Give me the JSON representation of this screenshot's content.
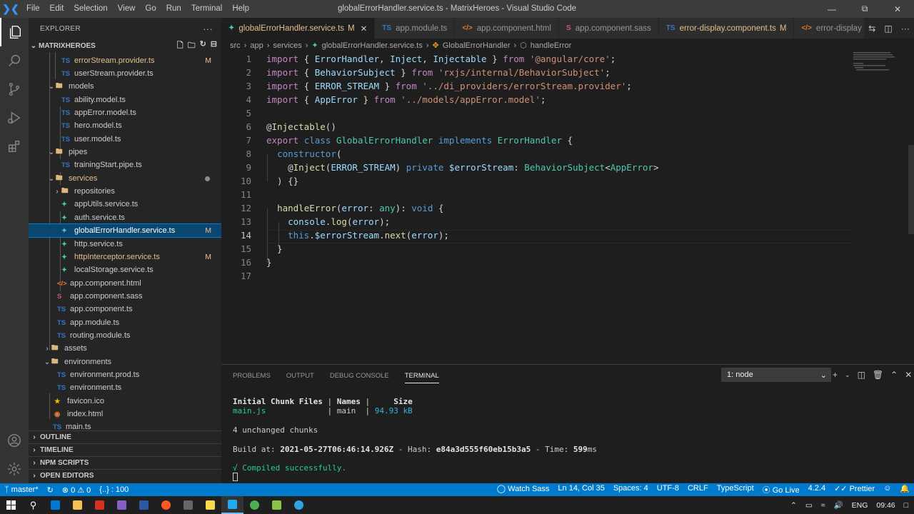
{
  "titlebar": {
    "menu": [
      "File",
      "Edit",
      "Selection",
      "View",
      "Go",
      "Run",
      "Terminal",
      "Help"
    ],
    "window_title": "globalErrorHandler.service.ts - MatrixHeroes - Visual Studio Code"
  },
  "explorer": {
    "title": "EXPLORER",
    "project": "MATRIXHEROES",
    "items": [
      {
        "label": "errorStream.provider.ts",
        "badge": "M"
      },
      {
        "label": "userStream.provider.ts"
      },
      {
        "label": "models"
      },
      {
        "label": "ability.model.ts"
      },
      {
        "label": "appError.model.ts"
      },
      {
        "label": "hero.model.ts"
      },
      {
        "label": "user.model.ts"
      },
      {
        "label": "pipes"
      },
      {
        "label": "trainingStart.pipe.ts"
      },
      {
        "label": "services"
      },
      {
        "label": "repositories"
      },
      {
        "label": "appUtils.service.ts"
      },
      {
        "label": "auth.service.ts"
      },
      {
        "label": "globalErrorHandler.service.ts",
        "badge": "M"
      },
      {
        "label": "http.service.ts"
      },
      {
        "label": "httpInterceptor.service.ts",
        "badge": "M"
      },
      {
        "label": "localStorage.service.ts"
      },
      {
        "label": "app.component.html"
      },
      {
        "label": "app.component.sass"
      },
      {
        "label": "app.component.ts"
      },
      {
        "label": "app.module.ts"
      },
      {
        "label": "routing.module.ts"
      },
      {
        "label": "assets"
      },
      {
        "label": "environments"
      },
      {
        "label": "environment.prod.ts"
      },
      {
        "label": "environment.ts"
      },
      {
        "label": "favicon.ico"
      },
      {
        "label": "index.html"
      },
      {
        "label": "main.ts"
      }
    ],
    "sections": [
      "OUTLINE",
      "TIMELINE",
      "NPM SCRIPTS",
      "OPEN EDITORS"
    ]
  },
  "tabs": [
    {
      "icon": "TS",
      "label": "globalErrorHandler.service.ts",
      "mod": "M"
    },
    {
      "icon": "TS",
      "label": "app.module.ts"
    },
    {
      "icon": "</>",
      "label": "app.component.html"
    },
    {
      "icon": "S",
      "label": "app.component.sass"
    },
    {
      "icon": "TS",
      "label": "error-display.component.ts",
      "mod": "M"
    },
    {
      "icon": "</>",
      "label": "error-display"
    }
  ],
  "breadcrumb": [
    "src",
    "app",
    "services",
    "globalErrorHandler.service.ts",
    "GlobalErrorHandler",
    "handleError"
  ],
  "code": {
    "line_numbers": [
      "1",
      "2",
      "3",
      "4",
      "5",
      "6",
      "7",
      "8",
      "9",
      "10",
      "11",
      "12",
      "13",
      "14",
      "15",
      "16",
      "17"
    ],
    "current_line": "14",
    "l1": {
      "a": "import",
      "b": " { ",
      "c": "ErrorHandler",
      "d": ", ",
      "e": "Inject",
      "f": ", ",
      "g": "Injectable",
      "h": " } ",
      "i": "from",
      "j": " ",
      "k": "'@angular/core'",
      "l": ";"
    },
    "l2": {
      "a": "import",
      "b": " { ",
      "c": "BehaviorSubject",
      "d": " } ",
      "e": "from",
      "f": " ",
      "g": "'rxjs/internal/BehaviorSubject'",
      "h": ";"
    },
    "l3": {
      "a": "import",
      "b": " { ",
      "c": "ERROR_STREAM",
      "d": " } ",
      "e": "from",
      "f": " ",
      "g": "'../di_providers/errorStream.provider'",
      "h": ";"
    },
    "l4": {
      "a": "import",
      "b": " { ",
      "c": "AppError",
      "d": " } ",
      "e": "from",
      "f": " ",
      "g": "'../models/appError.model'",
      "h": ";"
    },
    "l6": {
      "a": "@",
      "b": "Injectable",
      "c": "()"
    },
    "l7": {
      "a": "export",
      "b": " ",
      "c": "class",
      "d": " ",
      "e": "GlobalErrorHandler",
      "f": " ",
      "g": "implements",
      "h": " ",
      "i": "ErrorHandler",
      "j": " {"
    },
    "l8": {
      "a": "  ",
      "b": "constructor",
      "c": "("
    },
    "l9": {
      "a": "    @",
      "b": "Inject",
      "c": "(",
      "d": "ERROR_STREAM",
      "e": ") ",
      "f": "private",
      "g": " ",
      "h": "$errorStream",
      "i": ": ",
      "j": "BehaviorSubject",
      "k": "<",
      "l": "AppError",
      "m": ">"
    },
    "l10": {
      "a": "  ) {}"
    },
    "l12": {
      "a": "  ",
      "b": "handleError",
      "c": "(",
      "d": "error",
      "e": ": ",
      "f": "any",
      "g": "): ",
      "h": "void",
      "i": " {"
    },
    "l13": {
      "a": "    ",
      "b": "console",
      "c": ".",
      "d": "log",
      "e": "(",
      "f": "error",
      "g": ");"
    },
    "l14": {
      "a": "    ",
      "b": "this",
      "c": ".",
      "d": "$errorStream",
      "e": ".",
      "f": "next",
      "g": "(",
      "h": "error",
      "i": ");"
    },
    "l15": {
      "a": "  }"
    },
    "l16": {
      "a": "}"
    }
  },
  "panel": {
    "tabs": [
      "PROBLEMS",
      "OUTPUT",
      "DEBUG CONSOLE",
      "TERMINAL"
    ],
    "terminal_select": "1: node",
    "lines": {
      "h1": "Initial Chunk Files",
      "h2": "Names",
      "h3": "Size",
      "r1a": "main.js",
      "r1b": "main",
      "r1c": "94.93 kB",
      "unchanged": "4 unchanged chunks",
      "build_label": "Build at: ",
      "build_time": "2021-05-27T06:46:14.926Z",
      "hash_label": " - Hash: ",
      "hash": "e84a3d555f60eb15b3a5",
      "time_label": " - Time: ",
      "time": "599",
      "time_unit": "ms",
      "compiled": "√ Compiled successfully."
    }
  },
  "statusbar": {
    "branch": "master*",
    "errors": "0",
    "warnings": "0",
    "extra": "{..} : 100",
    "watch_sass": "Watch Sass",
    "position": "Ln 14, Col 35",
    "spaces": "Spaces: 4",
    "encoding": "UTF-8",
    "eol": "CRLF",
    "language": "TypeScript",
    "golive": "Go Live",
    "version": "4.2.4",
    "prettier": "Prettier"
  },
  "taskbar": {
    "lang": "ENG",
    "time": "09:46"
  },
  "colors": {
    "accent": "#007acc",
    "selection": "#094771",
    "modified": "#e2c08d"
  }
}
